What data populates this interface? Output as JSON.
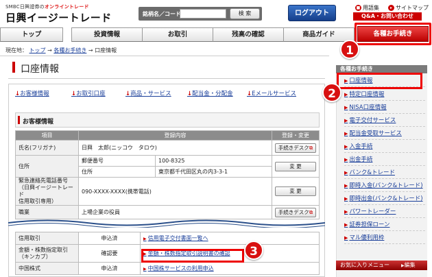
{
  "header": {
    "brand_tag_prefix": "SMBC日興證券の",
    "brand_tag_highlight": "オンライントレード",
    "brand_name": "日興イージートレード",
    "search_label": "銘柄名／コード",
    "search_value": "",
    "search_button": "検 索",
    "logout_button": "ログアウト",
    "glossary_link": "用語集",
    "sitemap_link": "サイトマップ",
    "qa_button": "Q&A・お問い合わせ"
  },
  "nav": {
    "tabs": [
      {
        "label": "トップ"
      },
      {
        "label": "投資情報"
      },
      {
        "label": "お取引"
      },
      {
        "label": "残高の確認"
      },
      {
        "label": "商品ガイド"
      },
      {
        "label": "各種お手続き"
      }
    ]
  },
  "breadcrumb": {
    "prefix": "現在地：",
    "items": [
      "トップ",
      "各種お手続き",
      "口座情報"
    ],
    "separator": "→"
  },
  "page": {
    "title": "口座情報"
  },
  "anchors": [
    {
      "label": "お客様情報"
    },
    {
      "label": "お取引口座"
    },
    {
      "label": "商品・サービス"
    },
    {
      "label": "配当金・分配金"
    },
    {
      "label": "Eメールサービス"
    }
  ],
  "section": {
    "title": "お客様情報",
    "columns": [
      "項目",
      "登録内容",
      "登録・変更"
    ],
    "rows": {
      "name_label": "氏名(フリガナ)",
      "name_value": "日興　太郎(ニッコウ　タロウ)",
      "name_button": "手続きデスク",
      "address_label": "住所",
      "postal_label": "郵便番号",
      "postal_value": "100-8325",
      "addr_sub_label": "住所",
      "addr_value": "東京都千代田区丸の内3-3-1",
      "address_button": "変 更",
      "emergency_label": "緊急連絡先電話番号\n（日興イージートレード\n信用取引専用）",
      "emergency_value": "090-XXXX-XXXX(携帯電話)",
      "emergency_button": "変 更",
      "job_label": "職業",
      "job_value": "上場企業の役員",
      "job_button": "手続きデスク"
    }
  },
  "services": {
    "rows": [
      {
        "label": "信用取引",
        "status": "申込済",
        "link": "信用電子交付書面一覧へ"
      },
      {
        "label": "金額・株数指定取引\n（キンカブ）",
        "status": "確認要",
        "link": "金額・株数指定取引説明書の確認"
      },
      {
        "label": "中国株式",
        "status": "申込済",
        "link": "中国株サービスの利用申込"
      }
    ]
  },
  "sidebar": {
    "header": "各種お手続き",
    "items": [
      {
        "label": "口座情報"
      },
      {
        "label": "特定口座情報"
      },
      {
        "label": "NISA口座情報"
      },
      {
        "label": "電子交付サービス"
      },
      {
        "label": "配当金受取サービス"
      },
      {
        "label": "入金手続"
      },
      {
        "label": "出金手続"
      },
      {
        "label": "バンク&トレード"
      },
      {
        "label": "即時入金(バンク&トレード)"
      },
      {
        "label": "即時出金(バンク&トレード)"
      },
      {
        "label": "パワートレーダー"
      },
      {
        "label": "証券担保ローン"
      },
      {
        "label": "マル優利用枠"
      }
    ],
    "favorites_label": "お気に入りメニュー",
    "favorites_edit": "編集"
  },
  "callouts": [
    "1",
    "2",
    "3"
  ],
  "colors": {
    "accent_red": "#d81010",
    "link_blue": "#1a3f9a",
    "logout_blue": "#153e8a"
  }
}
